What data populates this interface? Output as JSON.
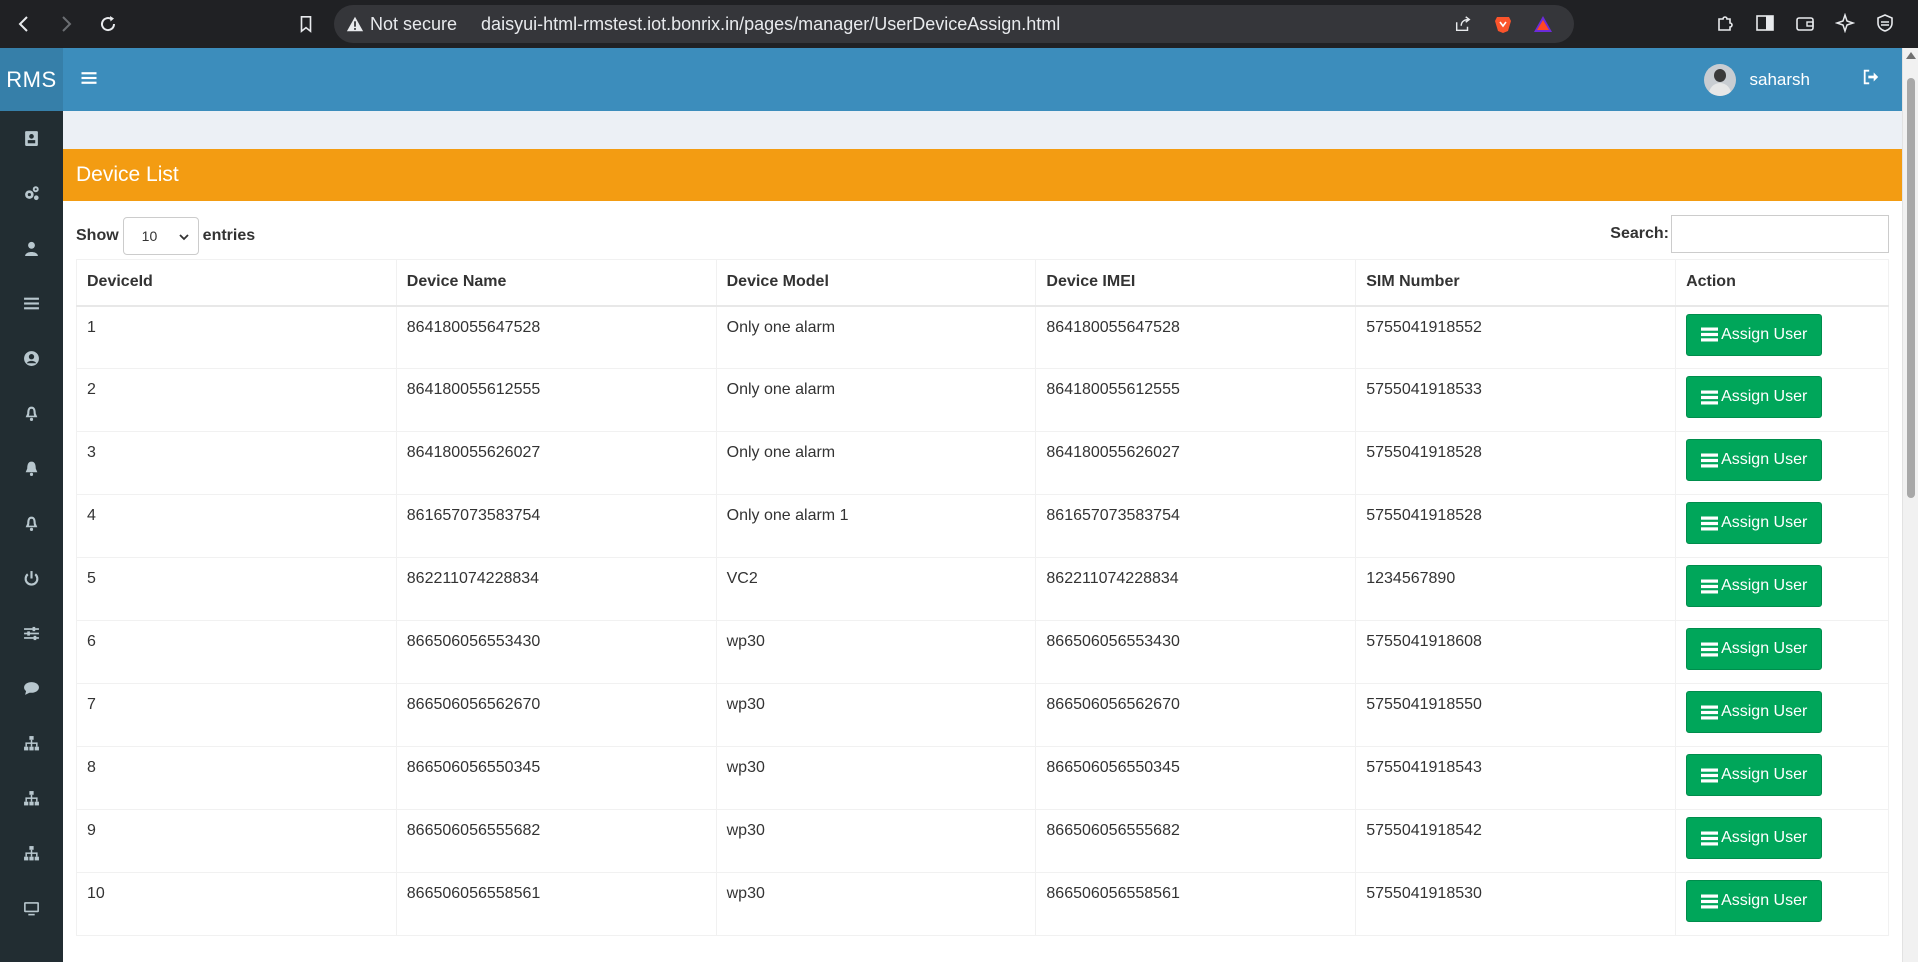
{
  "browser": {
    "not_secure": "Not secure",
    "url": "daisyui-html-rmstest.iot.bonrix.in/pages/manager/UserDeviceAssign.html"
  },
  "app": {
    "logo": "RMS",
    "username": "saharsh",
    "sidebar_icons": [
      "contact-card-icon",
      "gears-icon",
      "user-icon",
      "list-icon",
      "user-circle-icon",
      "bell-outline-icon",
      "bell-icon",
      "bell-outline-icon",
      "power-icon",
      "sliders-icon",
      "chat-icon",
      "sitemap-icon",
      "sitemap-icon",
      "sitemap-icon",
      "monitor-icon"
    ]
  },
  "card": {
    "title": "Device List",
    "show_label": "Show",
    "entries_value": "10",
    "entries_label": "entries",
    "search_label": "Search:",
    "search_value": ""
  },
  "table": {
    "columns": [
      "DeviceId",
      "Device Name",
      "Device Model",
      "Device IMEI",
      "SIM Number",
      "Action"
    ],
    "action_label": "Assign User",
    "rows": [
      {
        "id": "1",
        "name": "864180055647528",
        "model": "Only one alarm",
        "imei": "864180055647528",
        "sim": "5755041918552"
      },
      {
        "id": "2",
        "name": "864180055612555",
        "model": "Only one alarm",
        "imei": "864180055612555",
        "sim": "5755041918533"
      },
      {
        "id": "3",
        "name": "864180055626027",
        "model": "Only one alarm",
        "imei": "864180055626027",
        "sim": "5755041918528"
      },
      {
        "id": "4",
        "name": "861657073583754",
        "model": "Only one alarm 1",
        "imei": "861657073583754",
        "sim": "5755041918528"
      },
      {
        "id": "5",
        "name": "862211074228834",
        "model": "VC2",
        "imei": "862211074228834",
        "sim": "1234567890"
      },
      {
        "id": "6",
        "name": "866506056553430",
        "model": "wp30",
        "imei": "866506056553430",
        "sim": "5755041918608"
      },
      {
        "id": "7",
        "name": "866506056562670",
        "model": "wp30",
        "imei": "866506056562670",
        "sim": "5755041918550"
      },
      {
        "id": "8",
        "name": "866506056550345",
        "model": "wp30",
        "imei": "866506056550345",
        "sim": "5755041918543"
      },
      {
        "id": "9",
        "name": "866506056555682",
        "model": "wp30",
        "imei": "866506056555682",
        "sim": "5755041918542"
      },
      {
        "id": "10",
        "name": "866506056558561",
        "model": "wp30",
        "imei": "866506056558561",
        "sim": "5755041918530"
      }
    ]
  },
  "colors": {
    "header": "#3c8dbc",
    "logo_bg": "#367fa9",
    "sidebar": "#222d32",
    "card_header": "#f39c12",
    "assign_button": "#00a65a"
  }
}
